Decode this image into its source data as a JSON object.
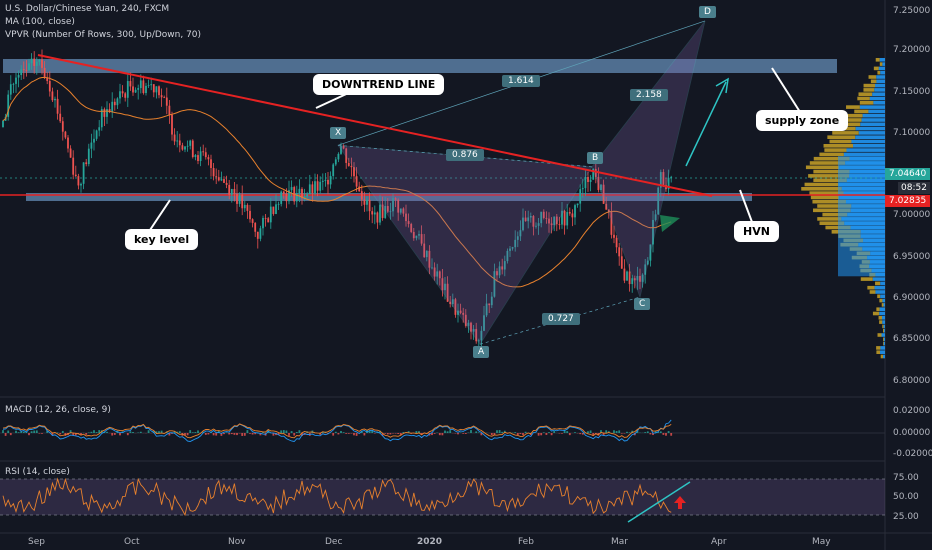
{
  "header": {
    "title": "U.S. Dollar/Chinese Yuan, 240, FXCM",
    "ma": "MA (100, close)",
    "vpvr": "VPVR (Number Of Rows, 300, Up/Down, 70)"
  },
  "chart_data": [
    {
      "type": "candlestick",
      "symbol": "USD/CNY",
      "y_axis": {
        "ticks": [
          "7.25000",
          "7.20000",
          "7.15000",
          "7.10000",
          "7.05000",
          "7.00000",
          "6.95000",
          "6.90000",
          "6.85000",
          "6.80000"
        ],
        "range": [
          6.78,
          7.26
        ]
      },
      "x_axis": {
        "ticks": [
          "Sep",
          "Oct",
          "Nov",
          "Dec",
          "2020",
          "Feb",
          "Mar",
          "Apr",
          "May"
        ]
      },
      "current_price": "7.04640",
      "countdown": "08:52",
      "level_price": "7.02835",
      "harmonic_points": [
        {
          "label": "X",
          "price": 7.088
        },
        {
          "label": "A",
          "price": 6.848
        },
        {
          "label": "B",
          "price": 7.062
        },
        {
          "label": "C",
          "price": 6.905
        },
        {
          "label": "D",
          "price": 7.238
        }
      ],
      "ratios": [
        "1.614",
        "0.876",
        "2.158",
        "0.727"
      ],
      "annotations": [
        "DOWNTREND LINE",
        "supply zone",
        "key level",
        "HVN"
      ]
    },
    {
      "type": "line",
      "name": "MACD (12, 26, close, 9)",
      "y_axis": {
        "ticks": [
          "0.02000",
          "0.00000",
          "-0.02000"
        ],
        "range": [
          -0.024,
          0.024
        ]
      }
    },
    {
      "type": "line",
      "name": "RSI (14, close)",
      "y_axis": {
        "ticks": [
          "75.00",
          "50.00",
          "25.00"
        ],
        "range": [
          10,
          90
        ]
      }
    }
  ],
  "colors": {
    "background": "#131722",
    "up": "#26a69a",
    "down": "#ef5350",
    "ma": "#e8812d",
    "downtrend": "#e52222",
    "harmonic": "#7b5fa5",
    "zone": "#5b7ea3",
    "volume_up": "#2196f3",
    "volume_down": "#c9a227",
    "rsi": "#e8812d",
    "arrow": "#2ec4c4"
  }
}
